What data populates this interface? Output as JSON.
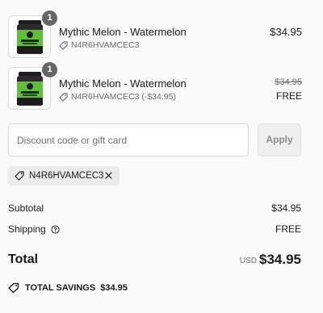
{
  "line_items": [
    {
      "quantity": "1",
      "title": "Mythic Melon - Watermelon",
      "discount_code": "N4R6HVAMCEC3",
      "price": "$34.95"
    },
    {
      "quantity": "1",
      "title": "Mythic Melon - Watermelon",
      "discount_code": "N4R6HVAMCEC3 (-$34.95)",
      "original_price": "$34.95",
      "final_price": "FREE"
    }
  ],
  "discount": {
    "placeholder": "Discount code or gift card",
    "apply_label": "Apply",
    "applied_code": "N4R6HVAMCEC3"
  },
  "summary": {
    "subtotal_label": "Subtotal",
    "subtotal_value": "$34.95",
    "shipping_label": "Shipping",
    "shipping_value": "FREE",
    "total_label": "Total",
    "currency": "USD",
    "total_value": "$34.95",
    "savings_label": "TOTAL SAVINGS",
    "savings_value": "$34.95"
  },
  "colors": {
    "badge": "#666666",
    "chip_bg": "#ebebeb",
    "apply_disabled_bg": "#efefef",
    "product_label_green": "#5fbf3a"
  },
  "icons": [
    "product-image",
    "tag-icon",
    "close-icon",
    "info-icon",
    "savings-tag-icon"
  ]
}
